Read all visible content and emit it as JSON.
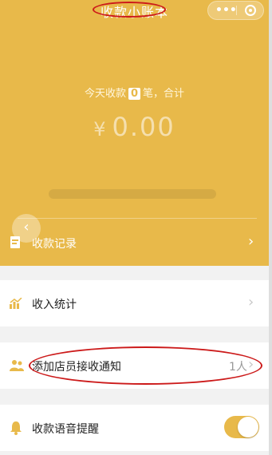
{
  "app": {
    "title": "收款小账本"
  },
  "capsule": {
    "more": "•••"
  },
  "summary": {
    "prefix": "今天收款",
    "count": "0",
    "suffix": "笔，合计",
    "currency": "¥",
    "amount": "0.00",
    "progress": 0
  },
  "back": {
    "glyph": "‹"
  },
  "record": {
    "label": "收款记录",
    "chevron": "›"
  },
  "menu": {
    "stats": {
      "label": "收入统计",
      "chevron": "›"
    },
    "notify": {
      "label": "添加店员接收通知",
      "value": "1人",
      "chevron": "›"
    },
    "voice": {
      "label": "收款语音提醒",
      "enabled": true
    }
  },
  "colors": {
    "accent": "#e8b94a",
    "annotation": "#cc1a1a",
    "background": "#f2f2f2"
  },
  "icons": {
    "record": "document-icon",
    "stats": "bar-chart-icon",
    "notify": "people-icon",
    "voice": "bell-icon"
  }
}
